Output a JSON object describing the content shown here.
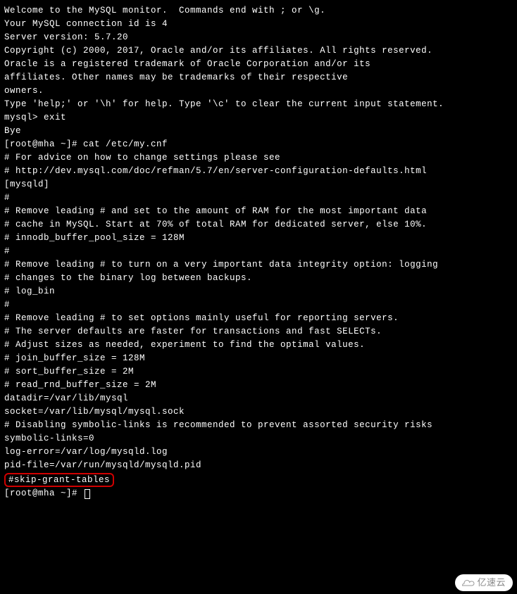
{
  "lines": {
    "l00": "Welcome to the MySQL monitor.  Commands end with ; or \\g.",
    "l01": "Your MySQL connection id is 4",
    "l02": "Server version: 5.7.20",
    "l03": "",
    "l04": "Copyright (c) 2000, 2017, Oracle and/or its affiliates. All rights reserved.",
    "l05": "",
    "l06": "Oracle is a registered trademark of Oracle Corporation and/or its",
    "l07": "affiliates. Other names may be trademarks of their respective",
    "l08": "owners.",
    "l09": "",
    "l10": "Type 'help;' or '\\h' for help. Type '\\c' to clear the current input statement.",
    "l11": "",
    "l12": "mysql> exit",
    "l13": "Bye",
    "l14": "[root@mha ~]# cat /etc/my.cnf",
    "l15": "# For advice on how to change settings please see",
    "l16": "# http://dev.mysql.com/doc/refman/5.7/en/server-configuration-defaults.html",
    "l17": "",
    "l18": "[mysqld]",
    "l19": "#",
    "l20": "# Remove leading # and set to the amount of RAM for the most important data",
    "l21": "# cache in MySQL. Start at 70% of total RAM for dedicated server, else 10%.",
    "l22": "# innodb_buffer_pool_size = 128M",
    "l23": "#",
    "l24": "# Remove leading # to turn on a very important data integrity option: logging",
    "l25": "# changes to the binary log between backups.",
    "l26": "# log_bin",
    "l27": "#",
    "l28": "# Remove leading # to set options mainly useful for reporting servers.",
    "l29": "# The server defaults are faster for transactions and fast SELECTs.",
    "l30": "# Adjust sizes as needed, experiment to find the optimal values.",
    "l31": "# join_buffer_size = 128M",
    "l32": "# sort_buffer_size = 2M",
    "l33": "# read_rnd_buffer_size = 2M",
    "l34": "datadir=/var/lib/mysql",
    "l35": "socket=/var/lib/mysql/mysql.sock",
    "l36": "",
    "l37": "# Disabling symbolic-links is recommended to prevent assorted security risks",
    "l38": "symbolic-links=0",
    "l39": "",
    "l40": "log-error=/var/log/mysqld.log",
    "l41": "pid-file=/var/run/mysqld/mysqld.pid"
  },
  "highlighted": "#skip-grant-tables",
  "prompt": "[root@mha ~]# ",
  "watermark": "亿速云"
}
